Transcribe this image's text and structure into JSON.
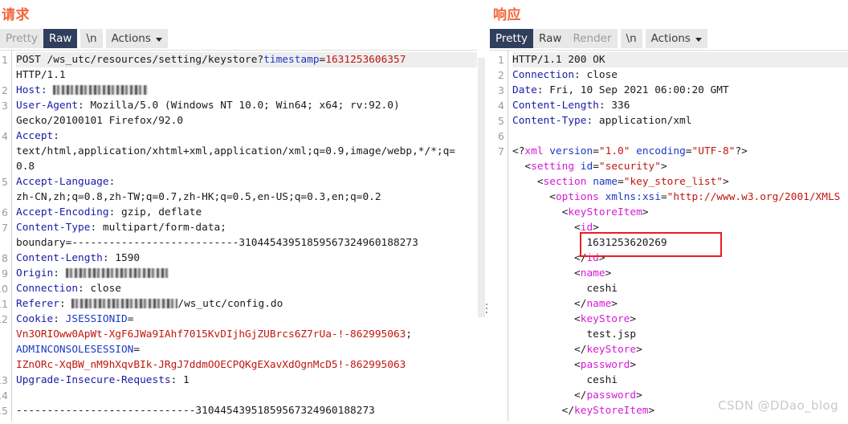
{
  "request": {
    "title": "请求",
    "tabs": [
      {
        "label": "Pretty",
        "state": "disabled"
      },
      {
        "label": "Raw",
        "state": "active"
      },
      {
        "label": "\\n",
        "state": "normal"
      },
      {
        "label": "Actions",
        "state": "normal",
        "icon": "chevron-down-icon"
      }
    ],
    "lines": [
      {
        "num": "1",
        "first": true,
        "parts": [
          {
            "t": "POST /ws_utc/resources/setting/keystore?",
            "c": "k-dark"
          },
          {
            "t": "timestamp",
            "c": "k-blue"
          },
          {
            "t": "=",
            "c": "k-dark"
          },
          {
            "t": "1631253606357",
            "c": "k-red"
          }
        ]
      },
      {
        "num": "",
        "parts": [
          {
            "t": "HTTP/1.1",
            "c": "k-dark"
          }
        ]
      },
      {
        "num": "2",
        "parts": [
          {
            "t": "Host: ",
            "c": "k-hdr"
          },
          {
            "t": "",
            "c": "redact",
            "w": 118
          }
        ]
      },
      {
        "num": "3",
        "parts": [
          {
            "t": "User-Agent",
            "c": "k-hdr"
          },
          {
            "t": ": Mozilla/5.0 (Windows NT 10.0; Win64; x64; rv:92.0)",
            "c": "k-dark"
          }
        ]
      },
      {
        "num": "",
        "parts": [
          {
            "t": "Gecko/20100101 Firefox/92.0",
            "c": "k-dark"
          }
        ]
      },
      {
        "num": "4",
        "parts": [
          {
            "t": "Accept",
            "c": "k-hdr"
          },
          {
            "t": ":",
            "c": "k-dark"
          }
        ]
      },
      {
        "num": "",
        "parts": [
          {
            "t": "text/html,application/xhtml+xml,application/xml;q=0.9,image/webp,*/*;q=",
            "c": "k-dark"
          }
        ]
      },
      {
        "num": "",
        "parts": [
          {
            "t": "0.8",
            "c": "k-dark"
          }
        ]
      },
      {
        "num": "5",
        "parts": [
          {
            "t": "Accept-Language",
            "c": "k-hdr"
          },
          {
            "t": ":",
            "c": "k-dark"
          }
        ]
      },
      {
        "num": "",
        "parts": [
          {
            "t": "zh-CN,zh;q=0.8,zh-TW;q=0.7,zh-HK;q=0.5,en-US;q=0.3,en;q=0.2",
            "c": "k-dark"
          }
        ]
      },
      {
        "num": "6",
        "parts": [
          {
            "t": "Accept-Encoding",
            "c": "k-hdr"
          },
          {
            "t": ": gzip, deflate",
            "c": "k-dark"
          }
        ]
      },
      {
        "num": "7",
        "parts": [
          {
            "t": "Content-Type",
            "c": "k-hdr"
          },
          {
            "t": ": multipart/form-data;",
            "c": "k-dark"
          }
        ]
      },
      {
        "num": "",
        "parts": [
          {
            "t": "boundary=---------------------------31044543951859567324960188273",
            "c": "k-dark"
          }
        ]
      },
      {
        "num": "8",
        "parts": [
          {
            "t": "Content-Length",
            "c": "k-hdr"
          },
          {
            "t": ": 1590",
            "c": "k-dark"
          }
        ]
      },
      {
        "num": "9",
        "parts": [
          {
            "t": "Origin",
            "c": "k-hdr"
          },
          {
            "t": ": ",
            "c": "k-dark"
          },
          {
            "t": "",
            "c": "redact",
            "w": 128
          }
        ]
      },
      {
        "num": "10",
        "parts": [
          {
            "t": "Connection",
            "c": "k-hdr"
          },
          {
            "t": ": close",
            "c": "k-dark"
          }
        ]
      },
      {
        "num": "11",
        "parts": [
          {
            "t": "Referer",
            "c": "k-hdr"
          },
          {
            "t": ": ",
            "c": "k-dark"
          },
          {
            "t": "",
            "c": "redact",
            "w": 132
          },
          {
            "t": "/ws_utc/config.do",
            "c": "k-dark"
          }
        ]
      },
      {
        "num": "12",
        "parts": [
          {
            "t": "Cookie",
            "c": "k-hdr"
          },
          {
            "t": ": ",
            "c": "k-dark"
          },
          {
            "t": "JSESSIONID",
            "c": "k-blue"
          },
          {
            "t": "=",
            "c": "k-dark"
          }
        ]
      },
      {
        "num": "",
        "parts": [
          {
            "t": "Vn3ORIOww0ApWt-XgF6JWa9IAhf7015KvDIjhGjZUBrcs6Z7rUa-!-862995063",
            "c": "k-red"
          },
          {
            "t": ";",
            "c": "k-dark"
          }
        ]
      },
      {
        "num": "",
        "parts": [
          {
            "t": "ADMINCONSOLESESSION",
            "c": "k-blue"
          },
          {
            "t": "=",
            "c": "k-dark"
          }
        ]
      },
      {
        "num": "",
        "parts": [
          {
            "t": "IZnORc-XqBW_nM9hXqvBIk-JRgJ7ddmOOECPQKgEXavXdOgnMcD5!-862995063",
            "c": "k-red"
          }
        ]
      },
      {
        "num": "13",
        "parts": [
          {
            "t": "Upgrade-Insecure-Requests",
            "c": "k-hdr"
          },
          {
            "t": ": 1",
            "c": "k-dark"
          }
        ]
      },
      {
        "num": "14",
        "parts": [
          {
            "t": "",
            "c": "k-dark"
          }
        ]
      },
      {
        "num": "15",
        "parts": [
          {
            "t": "-----------------------------31044543951859567324960188273",
            "c": "k-dark"
          }
        ]
      }
    ]
  },
  "response": {
    "title": "响应",
    "tabs": [
      {
        "label": "Pretty",
        "state": "active"
      },
      {
        "label": "Raw",
        "state": "normal"
      },
      {
        "label": "Render",
        "state": "disabled"
      },
      {
        "label": "\\n",
        "state": "normal"
      },
      {
        "label": "Actions",
        "state": "normal",
        "icon": "chevron-down-icon"
      }
    ],
    "lines": [
      {
        "num": "1",
        "first": true,
        "parts": [
          {
            "t": "HTTP/1.1 200 OK",
            "c": "k-dark"
          }
        ]
      },
      {
        "num": "2",
        "parts": [
          {
            "t": "Connection",
            "c": "k-hdr"
          },
          {
            "t": ": close",
            "c": "k-dark"
          }
        ]
      },
      {
        "num": "3",
        "parts": [
          {
            "t": "Date",
            "c": "k-hdr"
          },
          {
            "t": ": Fri, 10 Sep 2021 06:00:20 GMT",
            "c": "k-dark"
          }
        ]
      },
      {
        "num": "4",
        "parts": [
          {
            "t": "Content-Length",
            "c": "k-hdr"
          },
          {
            "t": ": 336",
            "c": "k-dark"
          }
        ]
      },
      {
        "num": "5",
        "parts": [
          {
            "t": "Content-Type",
            "c": "k-hdr"
          },
          {
            "t": ": application/xml",
            "c": "k-dark"
          }
        ]
      },
      {
        "num": "6",
        "parts": [
          {
            "t": "",
            "c": "k-dark"
          }
        ]
      },
      {
        "num": "7",
        "parts": [
          {
            "t": "<?",
            "c": "k-dark"
          },
          {
            "t": "xml",
            "c": "k-mag"
          },
          {
            "t": " ",
            "c": "k-dark"
          },
          {
            "t": "version",
            "c": "k-blue"
          },
          {
            "t": "=",
            "c": "k-dark"
          },
          {
            "t": "\"1.0\"",
            "c": "k-red"
          },
          {
            "t": " ",
            "c": "k-dark"
          },
          {
            "t": "encoding",
            "c": "k-blue"
          },
          {
            "t": "=",
            "c": "k-dark"
          },
          {
            "t": "\"UTF-8\"",
            "c": "k-red"
          },
          {
            "t": "?>",
            "c": "k-dark"
          }
        ]
      },
      {
        "num": "",
        "parts": [
          {
            "t": "  <",
            "c": "k-dark"
          },
          {
            "t": "setting",
            "c": "k-mag"
          },
          {
            "t": " ",
            "c": "k-dark"
          },
          {
            "t": "id",
            "c": "k-blue"
          },
          {
            "t": "=",
            "c": "k-dark"
          },
          {
            "t": "\"security\"",
            "c": "k-red"
          },
          {
            "t": ">",
            "c": "k-dark"
          }
        ]
      },
      {
        "num": "",
        "parts": [
          {
            "t": "    <",
            "c": "k-dark"
          },
          {
            "t": "section",
            "c": "k-mag"
          },
          {
            "t": " ",
            "c": "k-dark"
          },
          {
            "t": "name",
            "c": "k-blue"
          },
          {
            "t": "=",
            "c": "k-dark"
          },
          {
            "t": "\"key_store_list\"",
            "c": "k-red"
          },
          {
            "t": ">",
            "c": "k-dark"
          }
        ]
      },
      {
        "num": "",
        "parts": [
          {
            "t": "      <",
            "c": "k-dark"
          },
          {
            "t": "options",
            "c": "k-mag"
          },
          {
            "t": " ",
            "c": "k-dark"
          },
          {
            "t": "xmlns:xsi",
            "c": "k-blue"
          },
          {
            "t": "=",
            "c": "k-dark"
          },
          {
            "t": "\"http://www.w3.org/2001/XMLS",
            "c": "k-red"
          }
        ]
      },
      {
        "num": "",
        "parts": [
          {
            "t": "        <",
            "c": "k-dark"
          },
          {
            "t": "keyStoreItem",
            "c": "k-mag"
          },
          {
            "t": ">",
            "c": "k-dark"
          }
        ]
      },
      {
        "num": "",
        "parts": [
          {
            "t": "          <",
            "c": "k-dark"
          },
          {
            "t": "id",
            "c": "k-mag"
          },
          {
            "t": ">",
            "c": "k-dark"
          }
        ]
      },
      {
        "num": "",
        "parts": [
          {
            "t": "            1631253620269",
            "c": "k-dark"
          }
        ]
      },
      {
        "num": "",
        "parts": [
          {
            "t": "          </",
            "c": "k-dark"
          },
          {
            "t": "id",
            "c": "k-mag"
          },
          {
            "t": ">",
            "c": "k-dark"
          }
        ]
      },
      {
        "num": "",
        "parts": [
          {
            "t": "          <",
            "c": "k-dark"
          },
          {
            "t": "name",
            "c": "k-mag"
          },
          {
            "t": ">",
            "c": "k-dark"
          }
        ]
      },
      {
        "num": "",
        "parts": [
          {
            "t": "            ceshi",
            "c": "k-dark"
          }
        ]
      },
      {
        "num": "",
        "parts": [
          {
            "t": "          </",
            "c": "k-dark"
          },
          {
            "t": "name",
            "c": "k-mag"
          },
          {
            "t": ">",
            "c": "k-dark"
          }
        ]
      },
      {
        "num": "",
        "parts": [
          {
            "t": "          <",
            "c": "k-dark"
          },
          {
            "t": "keyStore",
            "c": "k-mag"
          },
          {
            "t": ">",
            "c": "k-dark"
          }
        ]
      },
      {
        "num": "",
        "parts": [
          {
            "t": "            test.jsp",
            "c": "k-dark"
          }
        ]
      },
      {
        "num": "",
        "parts": [
          {
            "t": "          </",
            "c": "k-dark"
          },
          {
            "t": "keyStore",
            "c": "k-mag"
          },
          {
            "t": ">",
            "c": "k-dark"
          }
        ]
      },
      {
        "num": "",
        "parts": [
          {
            "t": "          <",
            "c": "k-dark"
          },
          {
            "t": "password",
            "c": "k-mag"
          },
          {
            "t": ">",
            "c": "k-dark"
          }
        ]
      },
      {
        "num": "",
        "parts": [
          {
            "t": "            ceshi",
            "c": "k-dark"
          }
        ]
      },
      {
        "num": "",
        "parts": [
          {
            "t": "          </",
            "c": "k-dark"
          },
          {
            "t": "password",
            "c": "k-mag"
          },
          {
            "t": ">",
            "c": "k-dark"
          }
        ]
      },
      {
        "num": "",
        "parts": [
          {
            "t": "        </",
            "c": "k-dark"
          },
          {
            "t": "keyStoreItem",
            "c": "k-mag"
          },
          {
            "t": ">",
            "c": "k-dark"
          }
        ]
      }
    ],
    "highlight": {
      "value": "1631253620269",
      "color": "#ec1c24"
    }
  },
  "watermark": "CSDN @DDao_blog",
  "colors": {
    "title": "#f4663a",
    "tab_active_bg": "#2f3f5c",
    "tab_bg": "#e8e8e8",
    "highlight": "#ec1c24"
  }
}
